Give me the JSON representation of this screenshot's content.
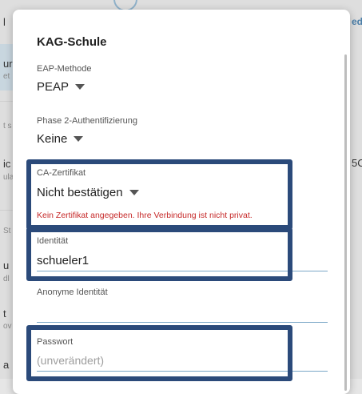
{
  "background": {
    "fragments": [
      "l",
      "ur",
      "et",
      "t s",
      "ic",
      "ula",
      "St",
      "u",
      "dl",
      "t",
      "ov",
      "a",
      "ed",
      "5C"
    ]
  },
  "dialog": {
    "title": "KAG-Schule",
    "eap": {
      "label": "EAP-Methode",
      "value": "PEAP"
    },
    "phase2": {
      "label": "Phase 2-Authentifizierung",
      "value": "Keine"
    },
    "ca": {
      "label": "CA-Zertifikat",
      "value": "Nicht bestätigen",
      "error": "Kein Zertifikat angegeben. Ihre Verbindung ist nicht privat."
    },
    "identity": {
      "label": "Identität",
      "value": "schueler1"
    },
    "anon": {
      "label": "Anonyme Identität",
      "value": ""
    },
    "password": {
      "label": "Passwort",
      "placeholder": "(unverändert)"
    }
  },
  "highlight_color": "#2b4a7a"
}
